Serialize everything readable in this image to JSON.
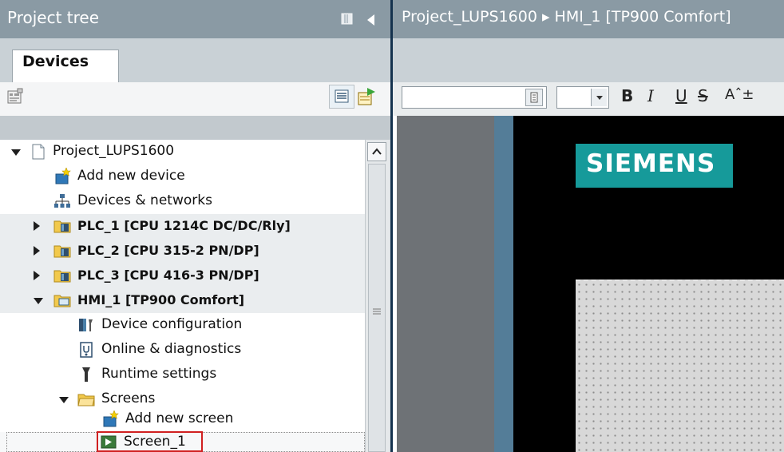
{
  "left_panel": {
    "title": "Project tree",
    "tab": "Devices",
    "tree": [
      {
        "label": "Project_LUPS1600",
        "icon": "project-icon",
        "expander": "expanded"
      },
      {
        "label": "Add new device",
        "icon": "add-device-icon",
        "expander": "none"
      },
      {
        "label": "Devices & networks",
        "icon": "network-icon",
        "expander": "none"
      },
      {
        "label": "PLC_1 [CPU 1214C DC/DC/Rly]",
        "icon": "plc-folder-icon",
        "expander": "collapsed"
      },
      {
        "label": "PLC_2 [CPU 315-2 PN/DP]",
        "icon": "plc-folder-icon",
        "expander": "collapsed"
      },
      {
        "label": "PLC_3 [CPU 416-3 PN/DP]",
        "icon": "plc-folder-icon",
        "expander": "collapsed"
      },
      {
        "label": "HMI_1 [TP900 Comfort]",
        "icon": "hmi-folder-icon",
        "expander": "expanded"
      },
      {
        "label": "Device configuration",
        "icon": "device-config-icon",
        "expander": "none"
      },
      {
        "label": "Online & diagnostics",
        "icon": "diagnostics-icon",
        "expander": "none"
      },
      {
        "label": "Runtime settings",
        "icon": "runtime-settings-icon",
        "expander": "none"
      },
      {
        "label": "Screens",
        "icon": "folder-icon",
        "expander": "expanded"
      },
      {
        "label": "Add new screen",
        "icon": "add-screen-icon",
        "expander": "none"
      },
      {
        "label": "Screen_1",
        "icon": "screen-icon",
        "expander": "none",
        "selected": true
      }
    ]
  },
  "right_panel": {
    "breadcrumb": "Project_LUPS1600  ▸  HMI_1 [TP900 Comfort]",
    "toolbar": {
      "bold": "B",
      "italic": "I",
      "underline": "U",
      "strikethrough": "S",
      "superscript": "Aˆ±"
    },
    "logo_text": "SIEMENS"
  },
  "colors": {
    "header_bg": "#8a9aa4",
    "siemens_teal": "#169a9a",
    "selection_red": "#d02020"
  }
}
